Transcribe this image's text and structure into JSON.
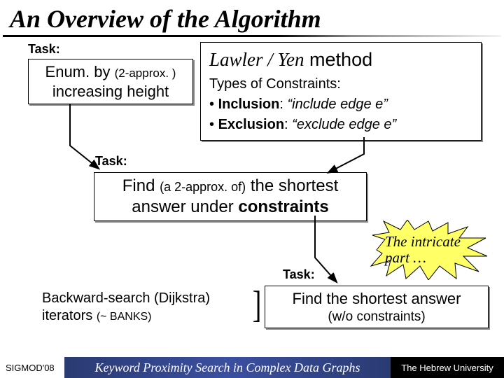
{
  "title": "An Overview of the Algorithm",
  "labels": {
    "task": "Task:"
  },
  "enum_box": {
    "line1_a": "Enum. by ",
    "line1_b": "(2-approx. )",
    "line2": "increasing height"
  },
  "lawler_box": {
    "head_i": "Lawler / Yen",
    "head_rest": " method",
    "types": "Types of Constraints:",
    "b1_bold": "Inclusion",
    "b1_rest": ": ",
    "b1_q": "“include edge e”",
    "b2_bold": "Exclusion",
    "b2_rest": ": ",
    "b2_q": "“exclude edge e”"
  },
  "find_box": {
    "l1_a": "Find ",
    "l1_small": "(a 2-approx. of)",
    "l1_b": " the shortest",
    "l2_a": "answer under ",
    "l2_bold": "constraints"
  },
  "star": {
    "l1": "The intricate",
    "l2": "part …"
  },
  "short_box": {
    "l1": "Find the shortest answer",
    "l2": "(w/o constraints)"
  },
  "backward": {
    "l1": "Backward-search (Dijkstra)",
    "l2_a": "iterators ",
    "l2_small": "(~ BANKS)"
  },
  "footer": {
    "left": "SIGMOD'08",
    "mid": "Keyword Proximity Search in Complex Data Graphs",
    "right": "The Hebrew University"
  }
}
